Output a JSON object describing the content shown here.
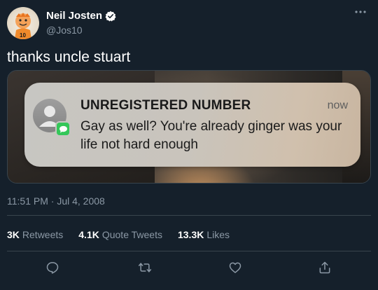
{
  "author": {
    "name": "Neil Josten",
    "handle": "@Jos10",
    "avatar_text": "10"
  },
  "tweet": {
    "text": "thanks uncle stuart",
    "timestamp": "11:51 PM · Jul 4, 2008"
  },
  "notification": {
    "title": "UNREGISTERED NUMBER",
    "time": "now",
    "body": "Gay as well? You're already ginger was your life not hard enough"
  },
  "stats": {
    "retweets_count": "3K",
    "retweets_label": "Retweets",
    "quotes_count": "4.1K",
    "quotes_label": "Quote Tweets",
    "likes_count": "13.3K",
    "likes_label": "Likes"
  },
  "icons": {
    "verified": "verified-badge-icon",
    "more": "more-icon",
    "reply": "reply-icon",
    "retweet": "retweet-icon",
    "like": "like-icon",
    "share": "share-icon",
    "message_app": "messages-app-icon"
  },
  "colors": {
    "background": "#15202b",
    "secondary_text": "#8b98a5",
    "divider": "#38444d",
    "messages_green": "#34c759"
  }
}
